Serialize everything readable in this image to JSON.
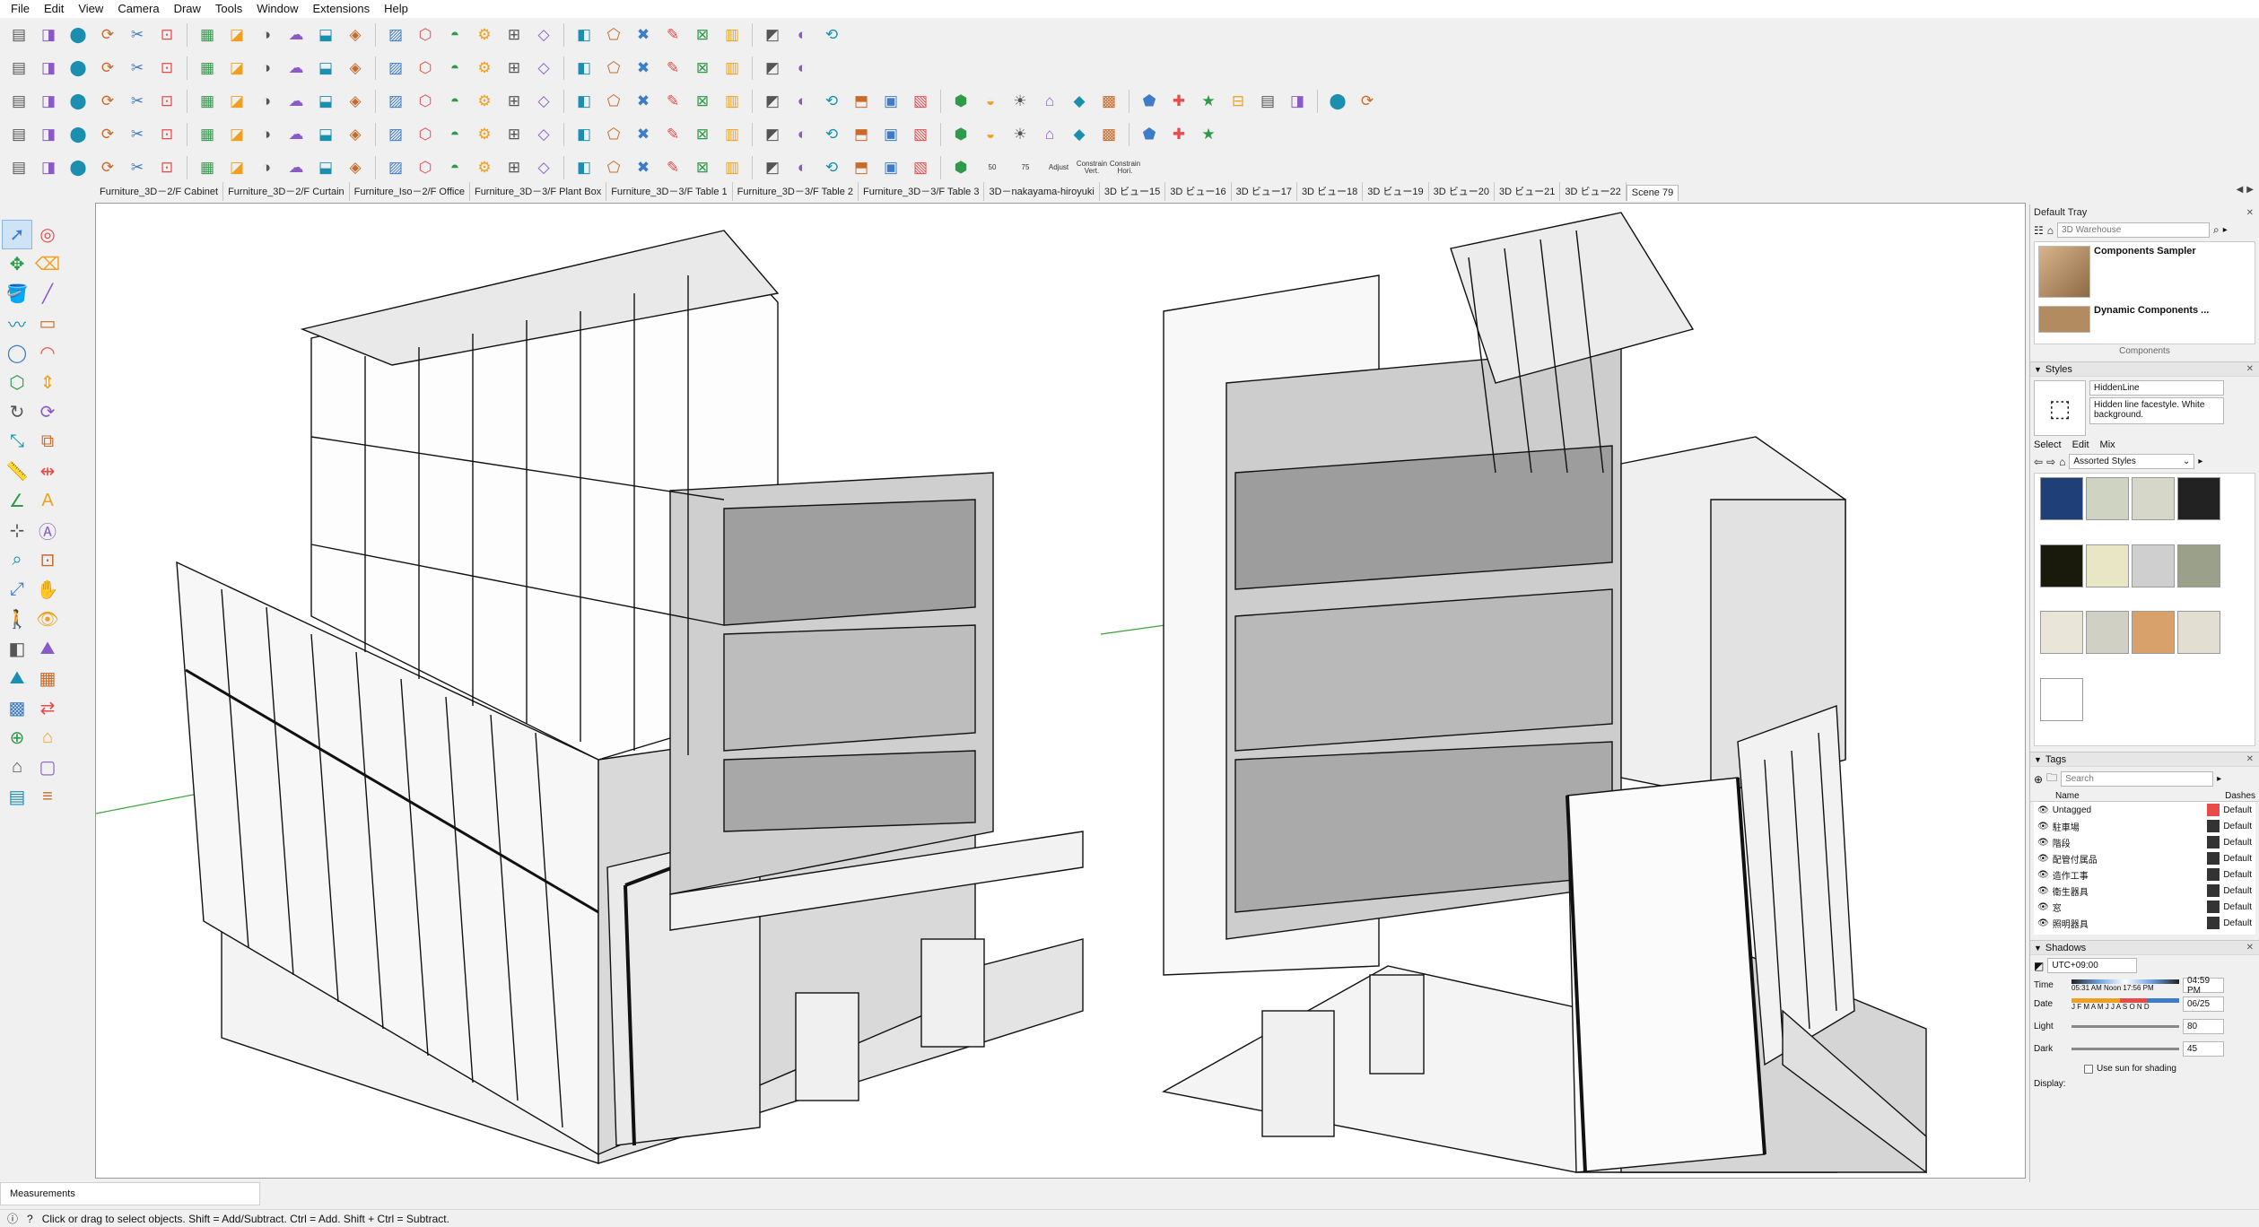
{
  "menu": [
    "File",
    "Edit",
    "View",
    "Camera",
    "Draw",
    "Tools",
    "Window",
    "Extensions",
    "Help"
  ],
  "toolbar_icons": {
    "row1": [
      "select-icon",
      "component-icon",
      "make-group-icon",
      "align-left-icon",
      "align-center-icon",
      "align-right-icon",
      "distribute-icon",
      "distribute-v-icon",
      "section-fill-icon",
      "grid-icon",
      "grid-2-icon",
      "table-icon",
      "table-2-icon",
      "hatch-icon",
      "cube-stack-icon",
      "cloud-icon",
      "contrast-icon",
      "bug-icon",
      "bug-2-icon",
      "move-3d-icon",
      "frame-icon",
      "frame-2-icon",
      "arrows-icon",
      "delete-arrows-icon",
      "window-icon",
      "pencil-red-icon",
      "red-box-icon"
    ],
    "row2": [
      "diamond-icon",
      "diamond-2-icon",
      "box-outline-icon",
      "loop-icon",
      "red-diamond-icon",
      "red-diamond-2-icon",
      "red-box-icon",
      "ring-icon",
      "compass-icon",
      "brush-icon",
      "shield-icon",
      "paint-icon",
      "molecule-icon",
      "cube-yellow-icon",
      "cube-green-icon",
      "cube-gray-icon",
      "folder-icon",
      "curve-icon",
      "sphere-icon",
      "sphere-plus-icon",
      "sphere-gray-icon",
      "question-icon",
      "globe-icon",
      "3b-icon",
      "green-slab-icon",
      "green-arrow-icon"
    ],
    "row3": [
      "push-pull-icon",
      "blue-plate-icon",
      "yellow-plate-icon",
      "orange-plate-icon",
      "red-plate-icon",
      "white-plate-icon",
      "curl-icon",
      "curl-2-icon",
      "curl-3-icon",
      "box-orange-icon",
      "table-3-icon",
      "hinge-icon",
      "hinge-2-icon",
      "hook-icon",
      "dots-icon",
      "dots-2-icon",
      "plus-red-icon",
      "plus-green-icon",
      "x-blue-icon",
      "grid-blue-icon",
      "tri-yellow-icon",
      "tri-blue-icon",
      "warning-icon",
      "refresh-icon",
      "star-icon",
      "gear-2-icon",
      "star-2-icon",
      "trash-icon",
      "arc-red-icon",
      "rainbow-icon",
      "ring-red-icon",
      "ring-2-icon",
      "spiral-icon",
      "spiral-2-icon",
      "cut-icon",
      "grid-green-icon",
      "grid-green-2-icon",
      "grid-green-3-icon",
      "cube-orange-icon",
      "cube-orange-2-icon",
      "cube-orange-3-icon",
      "dots-3-icon",
      "dash-circle-icon",
      "net-icon"
    ],
    "row4": [
      "ruler-icon",
      "t-square-icon",
      "bar-chart-icon",
      "circle-x-icon",
      "pencil-icon",
      "paint-bucket-icon",
      "box-open-icon",
      "box-open-2-icon",
      "scissors-icon",
      "tools-2-icon",
      "square-icon",
      "flag-icon",
      "window-2-icon",
      "list-icon",
      "pin-icon",
      "plug-icon",
      "doc-icon",
      "key-icon",
      "scissors-2-icon",
      "square-2-icon",
      "square-3-icon",
      "square-4-icon",
      "square-5-icon",
      "download-icon",
      "stack-icon",
      "sun-icon",
      "cloud-red-icon",
      "gear-orange-icon",
      "compass-2-icon",
      "play-icon",
      "stopwatch-icon",
      "leaf-icon",
      "battery-icon",
      "print-icon",
      "calendar-icon",
      "kanji-icon",
      "kanji-2-icon",
      "chart-icon",
      "chart-2-icon"
    ],
    "row5": [
      "folder-open-icon",
      "gear-icon",
      "red-no-icon",
      "camera-iso-icon",
      "count-50-icon",
      "count-75-icon",
      "sphere-half-icon",
      "eye-blue-icon",
      "half-moon-icon",
      "hatch-2-icon",
      "cloud-outline-icon",
      "cloud-2-icon",
      "hand-icon",
      "dot-icon",
      "dash-line-icon",
      "hex-icon",
      "hex-2-icon",
      "hex-3-icon",
      "hex-4-icon",
      "hex-5-icon",
      "cloud-3-icon",
      "cloud-4-icon",
      "adjust-icon",
      "constrain-vert-icon",
      "constrain-hori-icon",
      "copy-icon",
      "check-box-icon",
      "box-outline-2-icon",
      "cloud-upload-icon",
      "doc-2-icon",
      "layer-blue-icon"
    ]
  },
  "toolbar_texts": {
    "adjust": "Adjust",
    "constrain_vert": "Constrain Vert.",
    "constrain_hori": "Constrain Hori.",
    "count_50": "50",
    "count_75": "75"
  },
  "scenes": [
    "Furniture_3D－2/F Cabinet",
    "Furniture_3D－2/F Curtain",
    "Furniture_Iso－2/F Office",
    "Furniture_3D－3/F Plant Box",
    "Furniture_3D－3/F Table 1",
    "Furniture_3D－3/F Table 2",
    "Furniture_3D－3/F Table 3",
    "3D－nakayama-hiroyuki",
    "3D ビュー15",
    "3D ビュー16",
    "3D ビュー17",
    "3D ビュー18",
    "3D ビュー19",
    "3D ビュー20",
    "3D ビュー21",
    "3D ビュー22",
    "Scene 79"
  ],
  "active_scene": "Scene 79",
  "left_tools": [
    "select-icon",
    "orbit-icon",
    "move-icon",
    "eraser-icon",
    "paint-bucket-icon",
    "line-icon",
    "freehand-icon",
    "rectangle-icon",
    "circle-icon",
    "arc-icon",
    "polygon-icon",
    "push-pull-icon",
    "follow-me-icon",
    "rotate-icon",
    "scale-icon",
    "offset-icon",
    "tape-measure-icon",
    "dimension-icon",
    "protractor-icon",
    "text-icon",
    "axes-icon",
    "3d-text-icon",
    "zoom-icon",
    "zoom-window-icon",
    "zoom-extents-icon",
    "pan-icon",
    "walk-icon",
    "look-around-icon",
    "section-plane-icon",
    "sandbox-icon",
    "smoove-icon",
    "stamp-icon",
    "drape-icon",
    "flip-edge-icon",
    "add-detail-icon",
    "home-icon",
    "house-icon",
    "box-icon",
    "cabinet-icon",
    "stairs-icon"
  ],
  "tray": {
    "title": "Default Tray",
    "search_placeholder": "3D Warehouse",
    "components": [
      {
        "name": "Components Sampler"
      },
      {
        "name": "Dynamic Components ..."
      }
    ],
    "components_label": "Components",
    "styles": {
      "header": "Styles",
      "style_name": "HiddenLine",
      "description": "Hidden line facestyle. White background.",
      "tabs": [
        "Select",
        "Edit",
        "Mix"
      ],
      "collection": "Assorted Styles"
    },
    "tags": {
      "header": "Tags",
      "search_placeholder": "Search",
      "col_name": "Name",
      "col_dashes": "Dashes",
      "rows": [
        {
          "name": "Untagged",
          "color": "#e94b4b",
          "dashes": "Default"
        },
        {
          "name": "駐車場",
          "color": "#333333",
          "dashes": "Default"
        },
        {
          "name": "階段",
          "color": "#333333",
          "dashes": "Default"
        },
        {
          "name": "配管付属品",
          "color": "#333333",
          "dashes": "Default"
        },
        {
          "name": "造作工事",
          "color": "#333333",
          "dashes": "Default"
        },
        {
          "name": "衛生器具",
          "color": "#333333",
          "dashes": "Default"
        },
        {
          "name": "窓",
          "color": "#333333",
          "dashes": "Default"
        },
        {
          "name": "照明器具",
          "color": "#333333",
          "dashes": "Default"
        }
      ]
    },
    "shadows": {
      "header": "Shadows",
      "timezone": "UTC+09:00",
      "time_label": "Time",
      "time_marks": "05:31 AM  Noon  17:56 PM",
      "time_value": "04:59 PM",
      "date_label": "Date",
      "months": "J F M A M J J A S O N D",
      "date_value": "06/25",
      "light_label": "Light",
      "light_value": "80",
      "dark_label": "Dark",
      "dark_value": "45",
      "use_sun": "Use sun for shading",
      "display_label": "Display:"
    }
  },
  "measurements_label": "Measurements",
  "status_text": "Click or drag to select objects. Shift = Add/Subtract. Ctrl = Add. Shift + Ctrl = Subtract.",
  "colors": {
    "accent": "#3d7cc9",
    "red": "#e94b4b",
    "viewport_bg": "#ffffff"
  }
}
